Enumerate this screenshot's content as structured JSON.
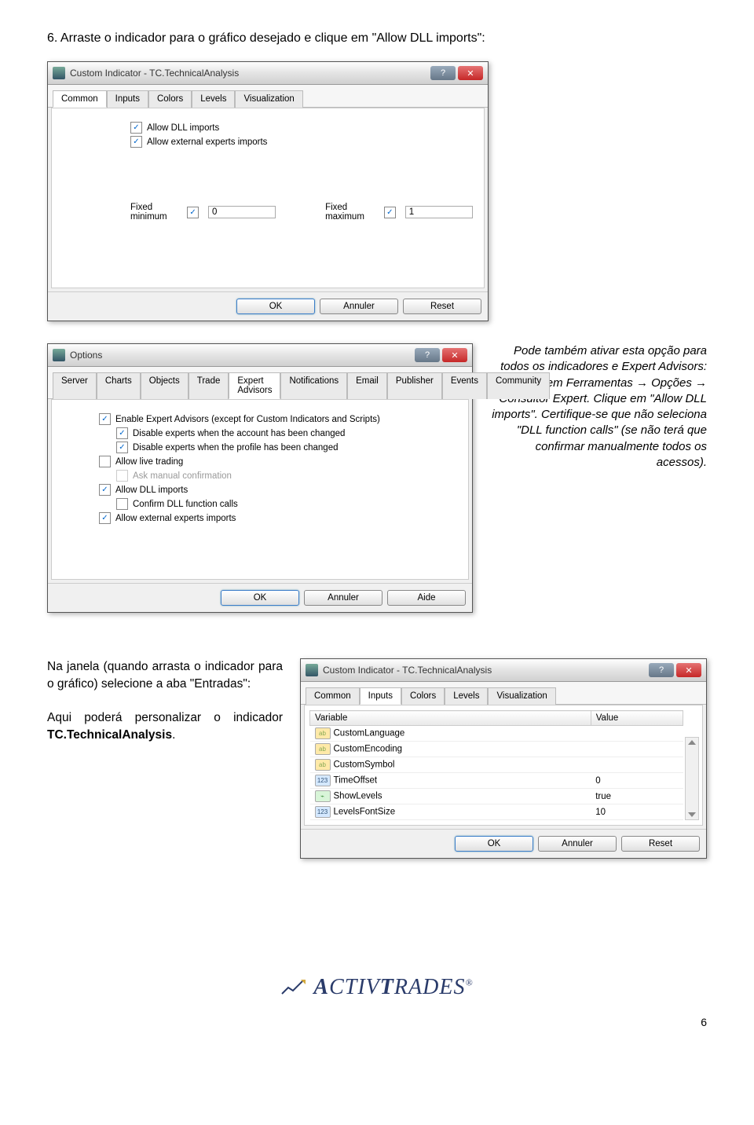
{
  "instruction": "6.  Arraste o indicador para o gráfico desejado e clique em \"Allow DLL imports\":",
  "dialog1": {
    "title": "Custom Indicator - TC.TechnicalAnalysis",
    "tabs": [
      "Common",
      "Inputs",
      "Colors",
      "Levels",
      "Visualization"
    ],
    "active_tab": 0,
    "checks": {
      "allow_dll": "Allow DLL imports",
      "allow_ext": "Allow external experts imports"
    },
    "fixed_min_label": "Fixed minimum",
    "fixed_min_value": "0",
    "fixed_max_label": "Fixed maximum",
    "fixed_max_value": "1",
    "buttons": {
      "ok": "OK",
      "cancel": "Annuler",
      "reset": "Reset"
    }
  },
  "note": "Pode também ativar esta opção para todos os indicadores e Expert Advisors:\nVá em Ferramentas → Opções → Consultor Expert. Clique em \"Allow DLL imports\". Certifique-se que não seleciona \"DLL function calls\" (se não terá que confirmar manualmente todos os acessos).",
  "dialog2": {
    "title": "Options",
    "tabs": [
      "Server",
      "Charts",
      "Objects",
      "Trade",
      "Expert Advisors",
      "Notifications",
      "Email",
      "Publisher",
      "Events",
      "Community"
    ],
    "active_tab": 4,
    "checks": {
      "enable": "Enable Expert Advisors (except for Custom Indicators and Scripts)",
      "disable_acct": "Disable experts when the account has been changed",
      "disable_prof": "Disable experts when the profile has been changed",
      "live": "Allow live trading",
      "ask": "Ask manual confirmation",
      "dll": "Allow DLL imports",
      "confirm": "Confirm DLL function calls",
      "ext": "Allow external experts imports"
    },
    "buttons": {
      "ok": "OK",
      "cancel": "Annuler",
      "help": "Aide"
    }
  },
  "block2_text": "Na janela (quando arrasta o indicador para o gráfico) selecione a aba \"Entradas\":",
  "block2_text2": "Aqui poderá personalizar o indicador TC.TechnicalAnalysis.",
  "dialog3": {
    "title": "Custom Indicator - TC.TechnicalAnalysis",
    "tabs": [
      "Common",
      "Inputs",
      "Colors",
      "Levels",
      "Visualization"
    ],
    "active_tab": 1,
    "col_var": "Variable",
    "col_val": "Value",
    "rows": [
      {
        "icon": "ab",
        "name": "CustomLanguage",
        "value": ""
      },
      {
        "icon": "ab",
        "name": "CustomEncoding",
        "value": ""
      },
      {
        "icon": "ab",
        "name": "CustomSymbol",
        "value": ""
      },
      {
        "icon": "num",
        "name": "TimeOffset",
        "value": "0"
      },
      {
        "icon": "bool",
        "name": "ShowLevels",
        "value": "true"
      },
      {
        "icon": "num",
        "name": "LevelsFontSize",
        "value": "10"
      }
    ],
    "buttons": {
      "ok": "OK",
      "cancel": "Annuler",
      "reset": "Reset"
    }
  },
  "logo": "ACTIVTRADES",
  "page": "6"
}
